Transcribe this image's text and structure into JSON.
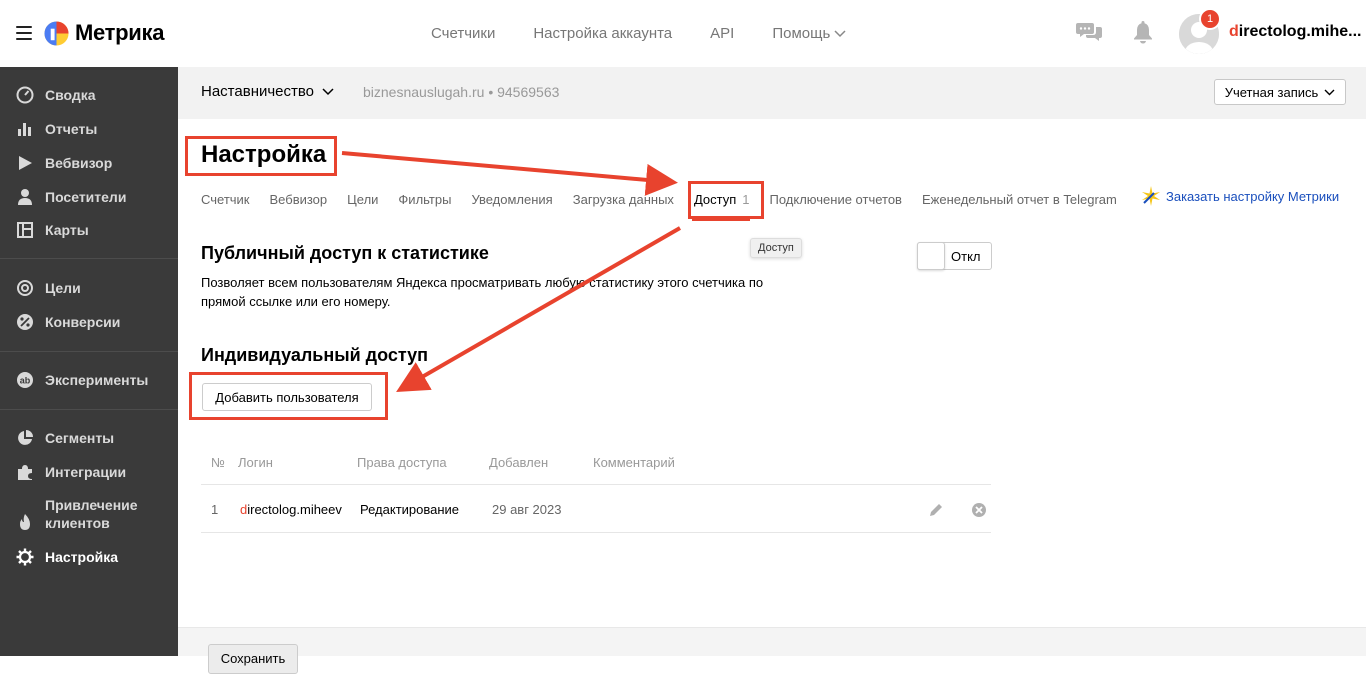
{
  "header": {
    "logo_text": "Метрика",
    "nav": [
      {
        "label": "Счетчики"
      },
      {
        "label": "Настройка аккаунта"
      },
      {
        "label": "API"
      },
      {
        "label": "Помощь"
      }
    ],
    "notification_count": "1",
    "username_first": "d",
    "username_rest": "irectolog.mihe..."
  },
  "sidebar": {
    "items": [
      {
        "label": "Сводка",
        "icon": "dashboard-icon"
      },
      {
        "label": "Отчеты",
        "icon": "bar-chart-icon"
      },
      {
        "label": "Вебвизор",
        "icon": "play-icon"
      },
      {
        "label": "Посетители",
        "icon": "user-icon"
      },
      {
        "label": "Карты",
        "icon": "map-icon"
      },
      {
        "label": "Цели",
        "icon": "target-icon"
      },
      {
        "label": "Конверсии",
        "icon": "percent-icon"
      },
      {
        "label": "Эксперименты",
        "icon": "ab-icon"
      },
      {
        "label": "Сегменты",
        "icon": "pie-icon"
      },
      {
        "label": "Интеграции",
        "icon": "puzzle-icon"
      },
      {
        "label": "Привлечение клиентов",
        "icon": "fire-icon"
      },
      {
        "label": "Настройка",
        "icon": "gear-icon"
      }
    ]
  },
  "subheader": {
    "counter_name": "Наставничество",
    "counter_site": "biznesnauslugah.ru",
    "counter_separator": "•",
    "counter_id": "94569563",
    "account_button": "Учетная запись"
  },
  "page": {
    "title": "Настройка",
    "tabs": [
      {
        "label": "Счетчик"
      },
      {
        "label": "Вебвизор"
      },
      {
        "label": "Цели"
      },
      {
        "label": "Фильтры"
      },
      {
        "label": "Уведомления"
      },
      {
        "label": "Загрузка данных"
      },
      {
        "label": "Доступ",
        "count": "1"
      },
      {
        "label": "Подключение отчетов"
      },
      {
        "label": "Еженедельный отчет в Telegram"
      }
    ],
    "order_link": "Заказать настройку Метрики",
    "tooltip": "Доступ",
    "public_access": {
      "title": "Публичный доступ к статистике",
      "description": "Позволяет всем пользователям Яндекса просматривать любую статистику этого счетчика по прямой ссылке или его номеру.",
      "toggle_label": "Откл"
    },
    "individual_access": {
      "title": "Индивидуальный доступ",
      "add_button": "Добавить пользователя"
    },
    "table": {
      "columns": [
        "№",
        "Логин",
        "Права доступа",
        "Добавлен",
        "Комментарий"
      ],
      "rows": [
        {
          "num": "1",
          "login_first": "d",
          "login_rest": "irectolog.miheev",
          "rights": "Редактирование",
          "added": "29 авг 2023",
          "comment": ""
        }
      ]
    },
    "save_button": "Сохранить"
  },
  "colors": {
    "accent_red": "#e8432e",
    "sidebar_bg": "#3a3a3a",
    "link_blue": "#1a4fbd"
  }
}
